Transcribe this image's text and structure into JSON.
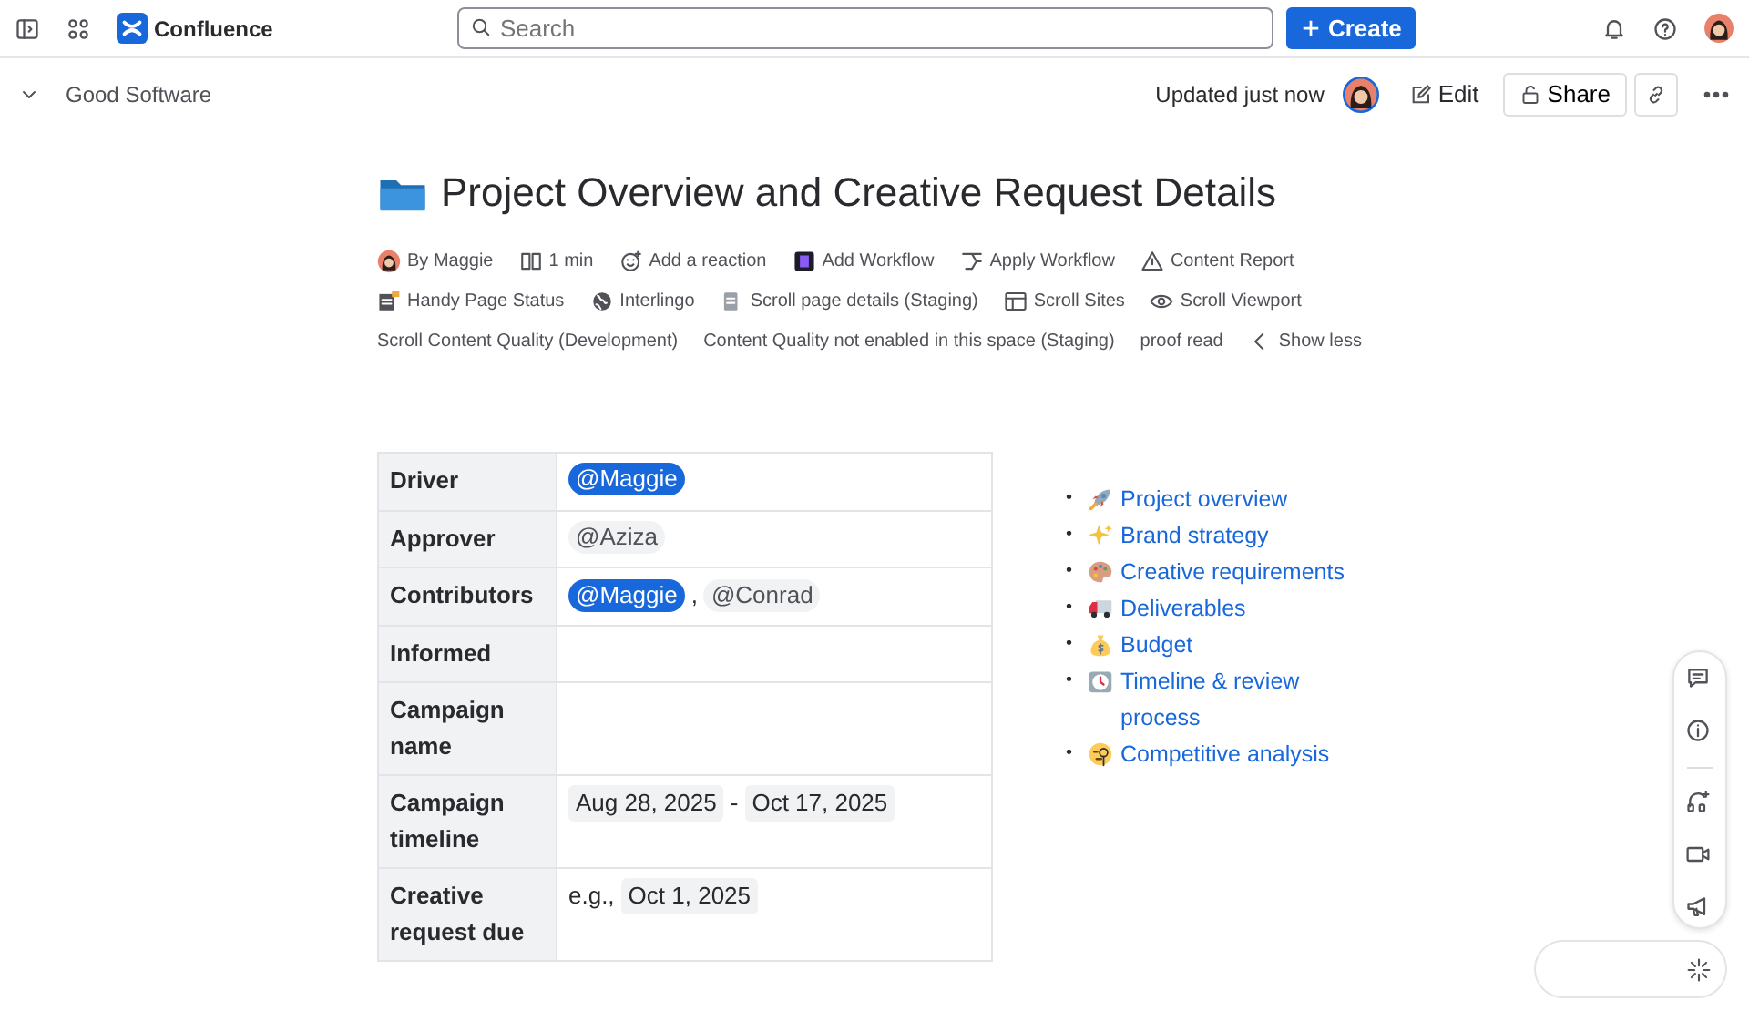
{
  "topbar": {
    "app_name": "Confluence",
    "search": {
      "placeholder": "Search"
    },
    "create_button": "Create"
  },
  "page_header": {
    "space": "Good Software",
    "updated": "Updated just now",
    "edit_button": "Edit",
    "share_button": "Share"
  },
  "title": "Project Overview and Creative Request Details",
  "byline_rows": [
    [
      {
        "kind": "avatar",
        "label": "By Maggie"
      },
      {
        "kind": "book",
        "label": "1 min"
      },
      {
        "kind": "smiley",
        "label": "Add a reaction"
      },
      {
        "kind": "workflow",
        "label": "Add Workflow"
      },
      {
        "kind": "branch",
        "label": "Apply Workflow"
      },
      {
        "kind": "warning",
        "label": "Content Report"
      }
    ],
    [
      {
        "kind": "status",
        "label": "Handy Page Status"
      },
      {
        "kind": "globe",
        "label": "Interlingo"
      },
      {
        "kind": "doc",
        "label": "Scroll page details (Staging)"
      },
      {
        "kind": "layout",
        "label": "Scroll Sites"
      },
      {
        "kind": "eye",
        "label": "Scroll Viewport"
      }
    ],
    [
      {
        "kind": "plain",
        "label": "Scroll Content Quality (Development)"
      },
      {
        "kind": "plain",
        "label": "Content Quality not enabled in this space (Staging)"
      },
      {
        "kind": "plain",
        "label": "proof read"
      },
      {
        "kind": "toggle",
        "label": "Show less"
      }
    ]
  ],
  "table": {
    "rows": [
      {
        "label": "Driver",
        "cells": [
          {
            "kind": "mention",
            "text": "@Maggie",
            "highlighted": true
          }
        ]
      },
      {
        "label": "Approver",
        "cells": [
          {
            "kind": "mention",
            "text": "@Aziza",
            "highlighted": false
          }
        ]
      },
      {
        "label": "Contributors",
        "cells": [
          {
            "kind": "mention",
            "text": "@Maggie",
            "highlighted": true
          },
          {
            "kind": "text",
            "text": ","
          },
          {
            "kind": "mention",
            "text": "@Conrad",
            "highlighted": false
          }
        ]
      },
      {
        "label": "Informed",
        "cells": []
      },
      {
        "label": "Campaign name",
        "cells": []
      },
      {
        "label": "Campaign timeline",
        "cells": [
          {
            "kind": "date",
            "text": "Aug 28, 2025"
          },
          {
            "kind": "text",
            "text": "-"
          },
          {
            "kind": "date",
            "text": "Oct 17, 2025"
          }
        ]
      },
      {
        "label": "Creative request due",
        "cells": [
          {
            "kind": "text",
            "text": "e.g.,"
          },
          {
            "kind": "date",
            "text": "Oct 1, 2025"
          }
        ]
      }
    ]
  },
  "toc": [
    {
      "bullet": "•",
      "kind": "rocket",
      "label": "Project overview"
    },
    {
      "bullet": "•",
      "kind": "sparkles",
      "label": "Brand strategy"
    },
    {
      "bullet": "•",
      "kind": "palette",
      "label": "Creative requirements"
    },
    {
      "bullet": "•",
      "kind": "truck",
      "label": "Deliverables"
    },
    {
      "bullet": "•",
      "kind": "moneybag",
      "label": "Budget"
    },
    {
      "bullet": "•",
      "kind": "clock",
      "label": "Timeline & review process"
    },
    {
      "bullet": "•",
      "kind": "monocle",
      "label": "Competitive analysis"
    }
  ]
}
